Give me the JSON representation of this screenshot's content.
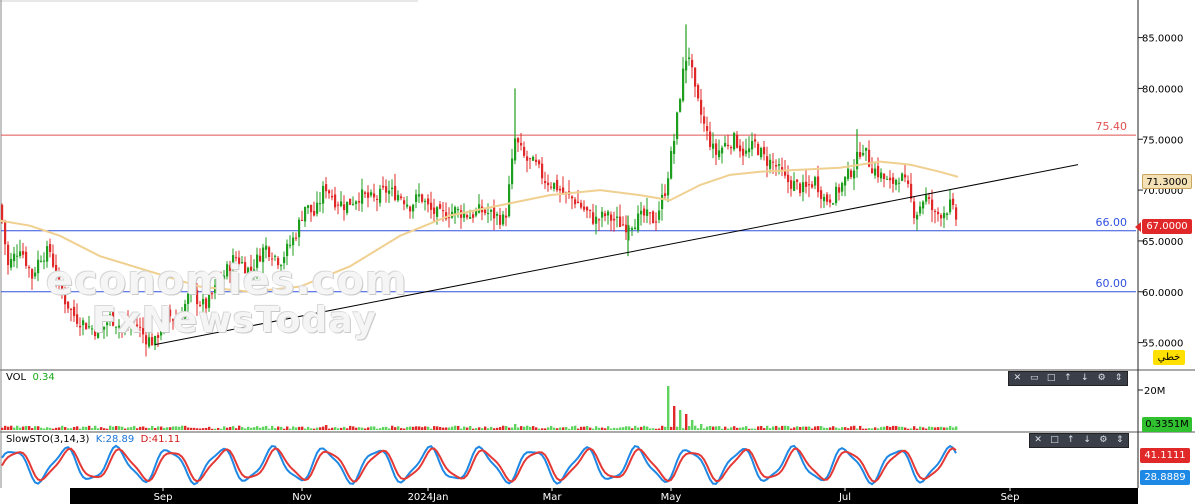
{
  "chart_data": [
    {
      "type": "candlestick",
      "title": "",
      "x_ticks": [
        "Sep",
        "Nov",
        "2024Jan",
        "Mar",
        "May",
        "Jul",
        "Sep"
      ],
      "y_ticks": [
        "85.0000",
        "80.0000",
        "75.0000",
        "70.0000",
        "65.0000",
        "60.0000",
        "55.0000"
      ],
      "ylim": [
        52.5,
        88.5
      ],
      "last_price": "67.0000",
      "moving_average_value": "71.3000",
      "horizontal_lines": [
        {
          "value": 75.4,
          "label": "75.40",
          "color": "#e05050"
        },
        {
          "value": 66.0,
          "label": "66.00",
          "color": "#3050e0"
        },
        {
          "value": 60.0,
          "label": "60.00",
          "color": "#3050e0"
        }
      ],
      "trendline": {
        "start": [
          155,
          54.8
        ],
        "end": [
          1078,
          72.5
        ],
        "color": "#000000"
      },
      "anchors": [
        [
          0,
          68.5
        ],
        [
          8,
          62.5
        ],
        [
          20,
          64.5
        ],
        [
          32,
          61.5
        ],
        [
          40,
          63.5
        ],
        [
          50,
          64.0
        ],
        [
          60,
          60.0
        ],
        [
          75,
          57.5
        ],
        [
          90,
          56.5
        ],
        [
          100,
          56.0
        ],
        [
          110,
          57.5
        ],
        [
          122,
          56.5
        ],
        [
          135,
          57.0
        ],
        [
          145,
          55.5
        ],
        [
          155,
          55.0
        ],
        [
          165,
          58.0
        ],
        [
          178,
          57.0
        ],
        [
          190,
          60.0
        ],
        [
          205,
          58.5
        ],
        [
          220,
          61.0
        ],
        [
          235,
          63.5
        ],
        [
          250,
          62.0
        ],
        [
          265,
          64.5
        ],
        [
          280,
          63.0
        ],
        [
          295,
          65.5
        ],
        [
          305,
          68.5
        ],
        [
          315,
          67.5
        ],
        [
          325,
          70.5
        ],
        [
          335,
          69.0
        ],
        [
          345,
          68.5
        ],
        [
          360,
          69.5
        ],
        [
          375,
          69.0
        ],
        [
          385,
          70.0
        ],
        [
          400,
          69.5
        ],
        [
          410,
          68.5
        ],
        [
          420,
          69.5
        ],
        [
          430,
          68.0
        ],
        [
          440,
          67.5
        ],
        [
          455,
          68.0
        ],
        [
          470,
          67.5
        ],
        [
          480,
          68.0
        ],
        [
          495,
          67.5
        ],
        [
          505,
          67.0
        ],
        [
          510,
          71.0
        ],
        [
          515,
          75.0
        ],
        [
          525,
          73.0
        ],
        [
          535,
          72.5
        ],
        [
          545,
          71.0
        ],
        [
          555,
          70.5
        ],
        [
          565,
          69.5
        ],
        [
          575,
          69.0
        ],
        [
          585,
          68.0
        ],
        [
          595,
          67.0
        ],
        [
          605,
          67.5
        ],
        [
          615,
          67.0
        ],
        [
          625,
          66.5
        ],
        [
          635,
          67.0
        ],
        [
          645,
          67.5
        ],
        [
          655,
          67.0
        ],
        [
          665,
          70.0
        ],
        [
          675,
          75.5
        ],
        [
          682,
          81.0
        ],
        [
          688,
          84.0
        ],
        [
          695,
          79.5
        ],
        [
          705,
          76.0
        ],
        [
          715,
          73.5
        ],
        [
          725,
          74.5
        ],
        [
          735,
          75.0
        ],
        [
          745,
          73.5
        ],
        [
          755,
          74.5
        ],
        [
          765,
          73.0
        ],
        [
          775,
          72.5
        ],
        [
          785,
          71.0
        ],
        [
          795,
          70.5
        ],
        [
          805,
          70.0
        ],
        [
          815,
          71.0
        ],
        [
          825,
          69.0
        ],
        [
          835,
          69.5
        ],
        [
          845,
          71.0
        ],
        [
          855,
          72.5
        ],
        [
          862,
          74.5
        ],
        [
          870,
          72.5
        ],
        [
          880,
          71.5
        ],
        [
          890,
          70.5
        ],
        [
          900,
          71.5
        ],
        [
          908,
          70.0
        ],
        [
          915,
          67.5
        ],
        [
          925,
          69.5
        ],
        [
          935,
          67.5
        ],
        [
          945,
          68.0
        ],
        [
          950,
          68.5
        ],
        [
          957,
          67.0
        ]
      ],
      "ma_points": [
        [
          0,
          67.0
        ],
        [
          30,
          66.5
        ],
        [
          60,
          65.5
        ],
        [
          100,
          63.5
        ],
        [
          150,
          62.0
        ],
        [
          200,
          60.5
        ],
        [
          250,
          60.0
        ],
        [
          300,
          60.5
        ],
        [
          350,
          62.5
        ],
        [
          400,
          65.5
        ],
        [
          450,
          67.5
        ],
        [
          500,
          68.5
        ],
        [
          550,
          69.5
        ],
        [
          600,
          70.0
        ],
        [
          640,
          69.5
        ],
        [
          670,
          69.0
        ],
        [
          700,
          70.5
        ],
        [
          730,
          71.5
        ],
        [
          760,
          71.8
        ],
        [
          800,
          72.0
        ],
        [
          840,
          72.2
        ],
        [
          880,
          72.8
        ],
        [
          910,
          72.5
        ],
        [
          940,
          71.8
        ],
        [
          958,
          71.3
        ]
      ]
    },
    {
      "type": "bar",
      "name": "VOL",
      "label": "VOL",
      "value": "0.34",
      "y_ticks": [
        "20M"
      ],
      "ylim": [
        0,
        25
      ],
      "last_value": "0.3351M",
      "spikes": [
        [
          325,
          2.5
        ],
        [
          505,
          2.0
        ],
        [
          515,
          3.0
        ],
        [
          669,
          22
        ],
        [
          675,
          12
        ],
        [
          680,
          10
        ],
        [
          686,
          8
        ],
        [
          692,
          5
        ],
        [
          700,
          3
        ],
        [
          710,
          2
        ]
      ]
    },
    {
      "type": "line",
      "name": "SlowSTO(3,14,3)",
      "label": "SlowSTO(3,14,3)",
      "k_label": "K:28.89",
      "d_label": "D:41.11",
      "ylim": [
        0,
        100
      ],
      "d_value": "41.1111",
      "k_value": "28.8889",
      "series": [
        {
          "name": "K",
          "color": "#1e88e5"
        },
        {
          "name": "D",
          "color": "#e53935"
        }
      ],
      "cycle_period": 52
    }
  ],
  "right_tag": "خطي",
  "colors": {
    "up": "#1e9e1e",
    "down": "#e02828",
    "ma": "#f0d090",
    "grid": "#dcdcdc",
    "axis_bg": "#ffffff",
    "time_axis_bg": "#000000",
    "volume_bar": "#5ed45e"
  }
}
